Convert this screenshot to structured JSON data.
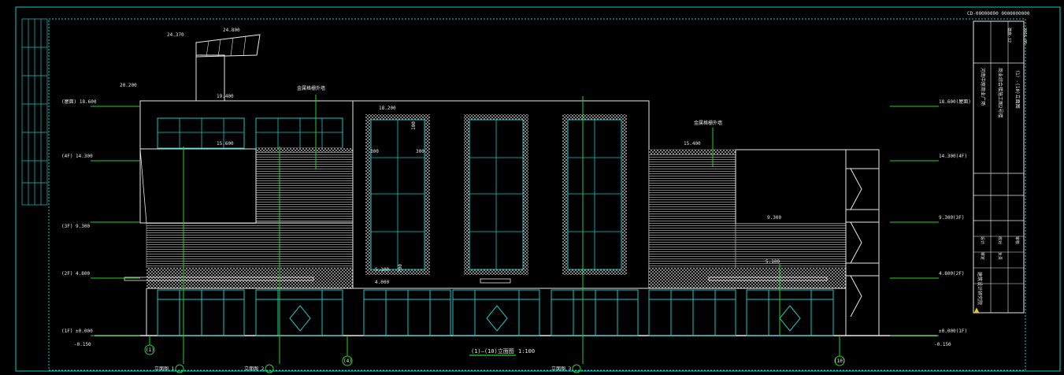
{
  "top_right_note": "CD-00000000 0000000000",
  "drawing_title": "(1)—(10)立面图",
  "scale": "1:100",
  "roof_top_elevations": [
    "24.370",
    "24.800"
  ],
  "upper_elevations": {
    "left_tall": "20.200",
    "roof": "19.400",
    "center": "18.200",
    "canopy_left": "15.600",
    "canopy_right": "15.400",
    "right_block": "9.300",
    "right_low": "5.100",
    "center_low": "5.100",
    "center_floor": "4.000",
    "side_300": "300",
    "side_300b": "300",
    "vert_100": "100",
    "vert_700": "700"
  },
  "left_levels": [
    "(屋面) 18.600",
    "(4F) 14.300",
    "(3F) 9.300",
    "(2F) 4.800",
    "(1F) ±0.000",
    "-0.150"
  ],
  "right_levels": [
    "18.600(屋面)",
    "14.300(4F)",
    "9.300(3F)",
    "4.800(2F)",
    "±0.000(1F)",
    "-0.150"
  ],
  "axis_labels": [
    "(1)",
    "(4)",
    "(10)"
  ],
  "section_tags": [
    "立面图 1",
    "立面图 2",
    "立面图 3"
  ],
  "leader_notes": [
    "金属格栅外墙",
    "金属格栅外墙"
  ],
  "title_block": {
    "project": "河南中原商业广场",
    "sheet": "（1）-(10)立面图",
    "sub": "商业综合楼施工图2号楼",
    "firm": "建筑设计研究院",
    "row_labels": [
      "设计",
      "校对",
      "审核",
      "审定",
      "负责"
    ],
    "drawing_no": "建施-12",
    "date": "2016.05"
  }
}
